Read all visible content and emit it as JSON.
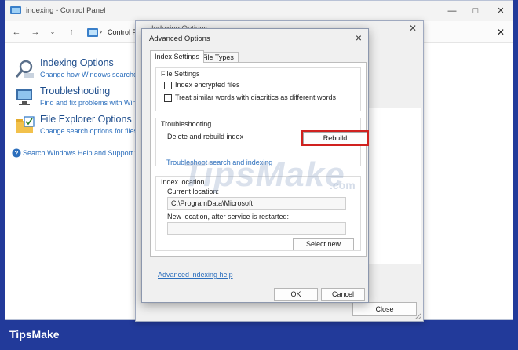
{
  "control_panel": {
    "title": "indexing - Control Panel",
    "address": "Control P",
    "items": [
      {
        "title": "Indexing Options",
        "subtitle": "Change how Windows searches"
      },
      {
        "title": "Troubleshooting",
        "subtitle": "Find and fix problems with Win"
      },
      {
        "title": "File Explorer Options",
        "subtitle": "Change search options for files"
      }
    ],
    "help_link": "Search Windows Help and Support f"
  },
  "indexing_window": {
    "title": "Indexing Options",
    "edge_text": "I",
    "close_button": "Close",
    "left_links": [
      "h",
      "T"
    ]
  },
  "advanced_options": {
    "title": "Advanced Options",
    "tabs": [
      "Index Settings",
      "File Types"
    ],
    "file_settings": {
      "label": "File Settings",
      "options": [
        "Index encrypted files",
        "Treat similar words with diacritics as different words"
      ]
    },
    "troubleshooting": {
      "label": "Troubleshooting",
      "delete_rebuild_label": "Delete and rebuild index",
      "rebuild_button": "Rebuild",
      "troubleshoot_link": "Troubleshoot search and indexing"
    },
    "index_location": {
      "label": "Index location",
      "current_label": "Current location:",
      "current_value": "C:\\ProgramData\\Microsoft",
      "new_label": "New location, after service is restarted:",
      "new_value": "",
      "select_new_button": "Select new"
    },
    "advanced_link": "Advanced indexing help",
    "ok_button": "OK",
    "cancel_button": "Cancel"
  },
  "watermark": {
    "main": "TipsMake",
    "suffix": ".com"
  },
  "footer_logo": "TipsMake",
  "colors": {
    "frame": "#223a9a",
    "link": "#2c6fbd",
    "highlight": "#d0211f"
  }
}
